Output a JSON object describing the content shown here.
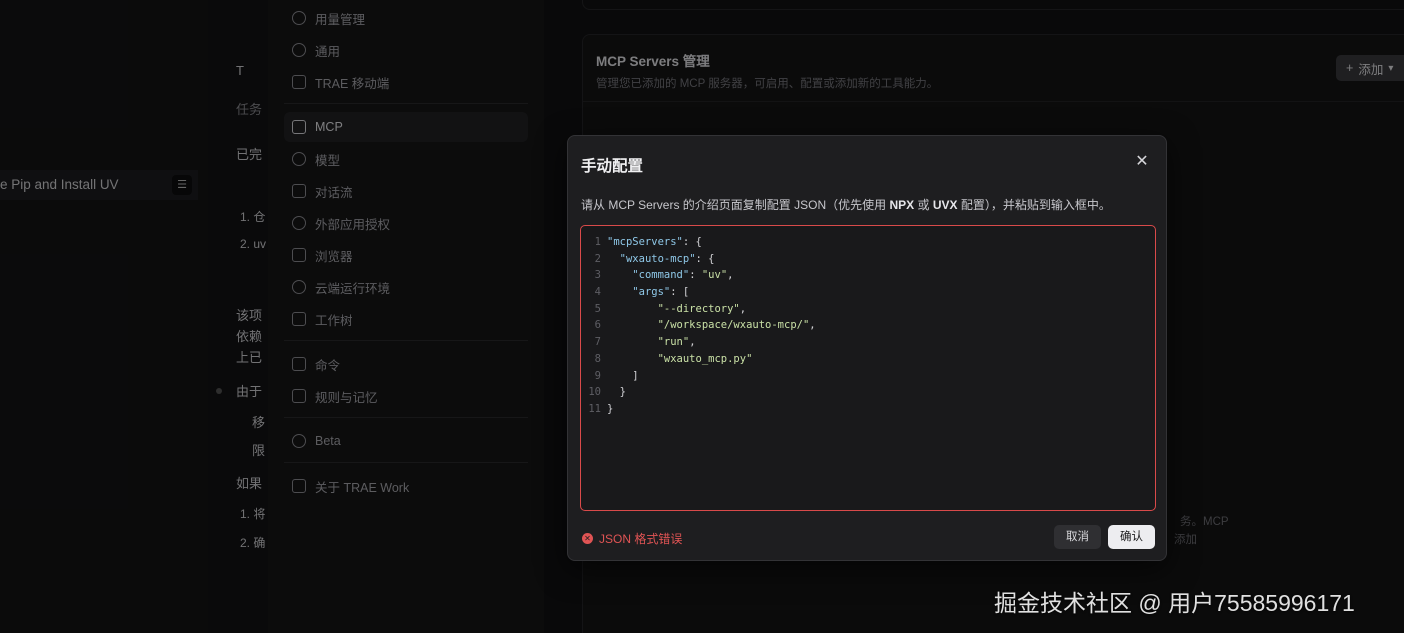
{
  "left_panel": {
    "task_item": "e Pip and Install UV",
    "chat_fragments": [
      "T",
      "任务",
      "已完",
      "1. 仓",
      "2. uv",
      "该项",
      "依赖",
      "上已",
      "由于",
      "移",
      "限",
      "如果",
      "1. 将",
      "2. 确"
    ]
  },
  "sidebar": {
    "items": [
      {
        "label": "用量管理",
        "icon": "usage-icon"
      },
      {
        "label": "通用",
        "icon": "gear-icon"
      },
      {
        "label": "TRAE 移动端",
        "icon": "mobile-icon"
      },
      {
        "label": "MCP",
        "icon": "wrench-icon",
        "active": true
      },
      {
        "label": "模型",
        "icon": "model-icon"
      },
      {
        "label": "对话流",
        "icon": "chat-flow-icon"
      },
      {
        "label": "外部应用授权",
        "icon": "auth-icon"
      },
      {
        "label": "浏览器",
        "icon": "browser-icon"
      },
      {
        "label": "云端运行环境",
        "icon": "cloud-icon"
      },
      {
        "label": "工作树",
        "icon": "worktree-icon"
      },
      {
        "label": "命令",
        "icon": "command-icon"
      },
      {
        "label": "规则与记忆",
        "icon": "rules-icon"
      },
      {
        "label": "Beta",
        "icon": "beta-icon"
      },
      {
        "label": "关于 TRAE Work",
        "icon": "about-icon"
      }
    ]
  },
  "main": {
    "card_title": "MCP Servers 管理",
    "card_subtitle": "管理您已添加的 MCP 服务器，可启用、配置或添加新的工具能力。",
    "add_button": "添加",
    "bg_text_1": "务。MCP",
    "bg_text_2": "添加"
  },
  "modal": {
    "title": "手动配置",
    "description_parts": [
      "请从 MCP Servers 的介绍页面复制配置 JSON（优先使用 ",
      "NPX",
      " 或 ",
      "UVX",
      " 配置），并粘贴到输入框中。"
    ],
    "code_lines": [
      "\"mcpServers\": {",
      "  \"wxauto-mcp\": {",
      "    \"command\": \"uv\",",
      "    \"args\": [",
      "        \"--directory\",",
      "        \"/workspace/wxauto-mcp/\",",
      "        \"run\",",
      "        \"wxauto_mcp.py\"",
      "    ]",
      "  }",
      "}"
    ],
    "error_text": "JSON 格式错误",
    "cancel_label": "取消",
    "confirm_label": "确认"
  },
  "watermark": "掘金技术社区 @ 用户75585996171",
  "colors": {
    "error": "#e05454",
    "modal_bg": "#1e1e20",
    "confirm_bg": "#ededf0"
  }
}
